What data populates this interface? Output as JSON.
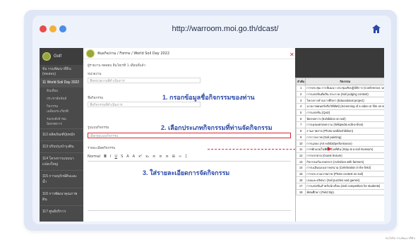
{
  "browser": {
    "url": "http://warroom.moi.go.th/dcast/",
    "dot_colors": [
      "#e94b4b",
      "#f0b23a",
      "#4b8de9"
    ],
    "accent": "#2c4aa8"
  },
  "sidebar": {
    "brand": "Golf",
    "items": [
      {
        "label": "ข้อ กรมพัฒนาที่ดิน (ทดสอบ)"
      },
      {
        "label": "11 World Soil Day 2022",
        "active": true
      },
      {
        "label": "ดินเสื่อม"
      },
      {
        "label": "ประชาสัมพันธ์"
      },
      {
        "label": "กิจกรรมเฉลิมพระเกียรติ"
      },
      {
        "label": "รณรงค์เข้าชมนิทรรศการ"
      },
      {
        "label": "112 ผลิตภัณฑ์ปุ๋ยหมัก"
      },
      {
        "label": "113 ปรับปรุงบำรุงดิน"
      },
      {
        "label": "114 โครงการแบบนาแปลงใหญ่"
      },
      {
        "label": "115 การอนุรักษ์ดินและน้ำ"
      },
      {
        "label": "116 การพัฒนาคุณภาพดิน"
      },
      {
        "label": "117 ศูนย์บริการ"
      }
    ]
  },
  "form": {
    "breadcrumb": "พันธกิจ/กรม / Forms / World Soil Day 2022",
    "meta_line": "ผู้รายงาน ทดสอบ อินโทเรทิ 1 เดือนที่แล้ว",
    "field1_label": "หน่วยงาน",
    "field1_value": "ชื่อหน่วยงานที่ดำเนินการ",
    "field2_label": "ชื่อกิจกรรม",
    "field2_value": "ชื่อกิจกรรมที่ดำเนินการ",
    "field3_label": "รูปแบบกิจกรรม",
    "field3_value": "เลือกรูปแบบกิจกรรม",
    "field4_label": "รายละเอียดกิจกรรม",
    "toolbar": [
      "Normal",
      "B",
      "I",
      "U",
      "S",
      "A",
      "A",
      "x²",
      "x₂",
      "≡",
      "≡",
      "≡",
      "⊞",
      "∞",
      "⌶"
    ],
    "annotation1": "1. กรอกข้อมูลชื่อกิจกรรมของท่าน",
    "annotation2": "2. เลือกประเภทกิจกรรมที่ท่านจัดกิจกรรม",
    "annotation3": "3. ใส่รายละเอียดการจัดกิจกรรม"
  },
  "table": {
    "headers": [
      "ลำดับ",
      "กิจกรรม"
    ],
    "rows": [
      {
        "n": "1",
        "text": "การประชุม การสัมมนา ประชุมเชิงปฏิบัติการ (Conference, workshop or symposium)"
      },
      {
        "n": "2",
        "text": "การแข่งขันตัดสิน ประกวด (Soil judging contest)"
      },
      {
        "n": "3",
        "text": "โครงการด้านการศึกษา (Educational project)"
      },
      {
        "n": "4",
        "text": "ฉายภาพยนตร์หรือวิดีทัศน์ (Screening of a video or film on soil)"
      },
      {
        "n": "5",
        "text": "การแข่งขัน (Quiz)"
      },
      {
        "n": "6",
        "text": "นิทรรศการ (Exhibition on soil)"
      },
      {
        "n": "7",
        "text": "การเผยแพร่บทความ (Wikipedia edit-a-thon)"
      },
      {
        "n": "8",
        "text": "งานภาพถ่าย (Photo walk/exhibition)"
      },
      {
        "n": "9",
        "text": "การวาดภาพ (Soil painting)"
      },
      {
        "n": "10",
        "text": "การแสดง (Art exhibit/performance)"
      },
      {
        "n": "11",
        "text": "การพักแรมในพิพิธภัณฑ์ดิน (Stay at a soil museum)"
      },
      {
        "n": "12",
        "text": "การบรรยาย (Guest lecture)"
      },
      {
        "n": "13",
        "text": "กิจกรรมกับเกษตรกร (Activities with farmers)"
      },
      {
        "n": "14",
        "text": "การเฉลิมฉลองภาคสนาม (Celebration in the field)"
      },
      {
        "n": "15",
        "text": "การประกวดภาพถ่าย (Photo contest on soil)"
      },
      {
        "n": "16",
        "text": "เกมและปริศนา (Soil puzzles and games)"
      },
      {
        "n": "17",
        "text": "การแข่งขันสำหรับนักเรียน (Soil competition for students)"
      },
      {
        "n": "18",
        "text": "ทัศนศึกษา (Field trip)"
      }
    ]
  },
  "caption": "สนใจดิน กรมพัฒนาที่ดิน"
}
